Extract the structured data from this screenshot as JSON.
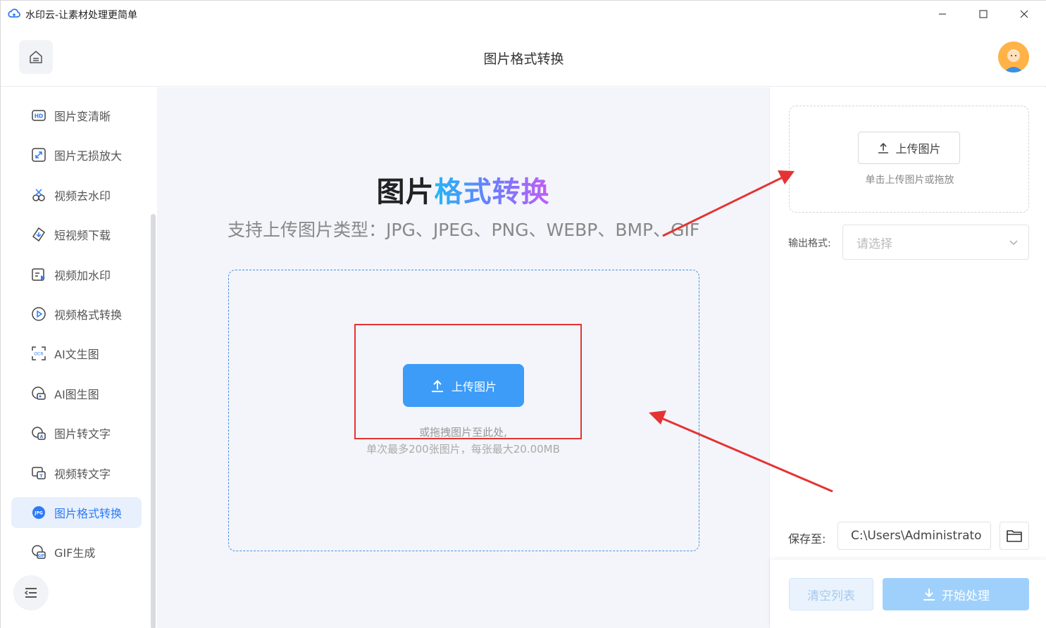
{
  "window": {
    "title": "水印云-让素材处理更简单",
    "minimize_icon": "minimize-icon",
    "maximize_icon": "maximize-icon",
    "close_icon": "close-icon"
  },
  "header": {
    "title": "图片格式转换",
    "home_icon": "home-icon",
    "avatar": "user-avatar"
  },
  "sidebar": {
    "items": [
      {
        "label": "图片变清晰",
        "icon": "hd-icon"
      },
      {
        "label": "图片无损放大",
        "icon": "enlarge-icon"
      },
      {
        "label": "视频去水印",
        "icon": "video-watermark-remove-icon"
      },
      {
        "label": "短视频下载",
        "icon": "download-icon"
      },
      {
        "label": "视频加水印",
        "icon": "video-add-watermark-icon"
      },
      {
        "label": "视频格式转换",
        "icon": "play-circle-icon"
      },
      {
        "label": "AI文生图",
        "icon": "ocr-icon"
      },
      {
        "label": "AI图生图",
        "icon": "ai-image-icon"
      },
      {
        "label": "图片转文字",
        "icon": "image-to-text-icon"
      },
      {
        "label": "视频转文字",
        "icon": "video-to-text-icon"
      },
      {
        "label": "图片格式转换",
        "icon": "jpg-icon",
        "active": true
      },
      {
        "label": "GIF生成",
        "icon": "gif-icon"
      }
    ],
    "toggle_icon": "menu-collapse-icon"
  },
  "main": {
    "hero_title_dark": "图片",
    "hero_title_gradient": "格式转换",
    "supported_types": "支持上传图片类型：JPG、JPEG、PNG、WEBP、BMP、GIF",
    "upload_button": "上传图片",
    "drop_hint_line1": "或拖拽图片至此处,",
    "drop_hint_line2": "单次最多200张图片，每张最大20.00MB"
  },
  "right_panel": {
    "upload_button": "上传图片",
    "upload_hint": "单击上传图片或拖放",
    "format_label": "输出格式:",
    "format_placeholder": "请选择",
    "save_label": "保存至:",
    "save_path": "C:\\Users\\Administrato",
    "clear_button": "清空列表",
    "start_button": "开始处理"
  },
  "colors": {
    "accent": "#3d9cf7",
    "active_bg": "#e8f0fe",
    "annotation_red": "#e53333"
  }
}
